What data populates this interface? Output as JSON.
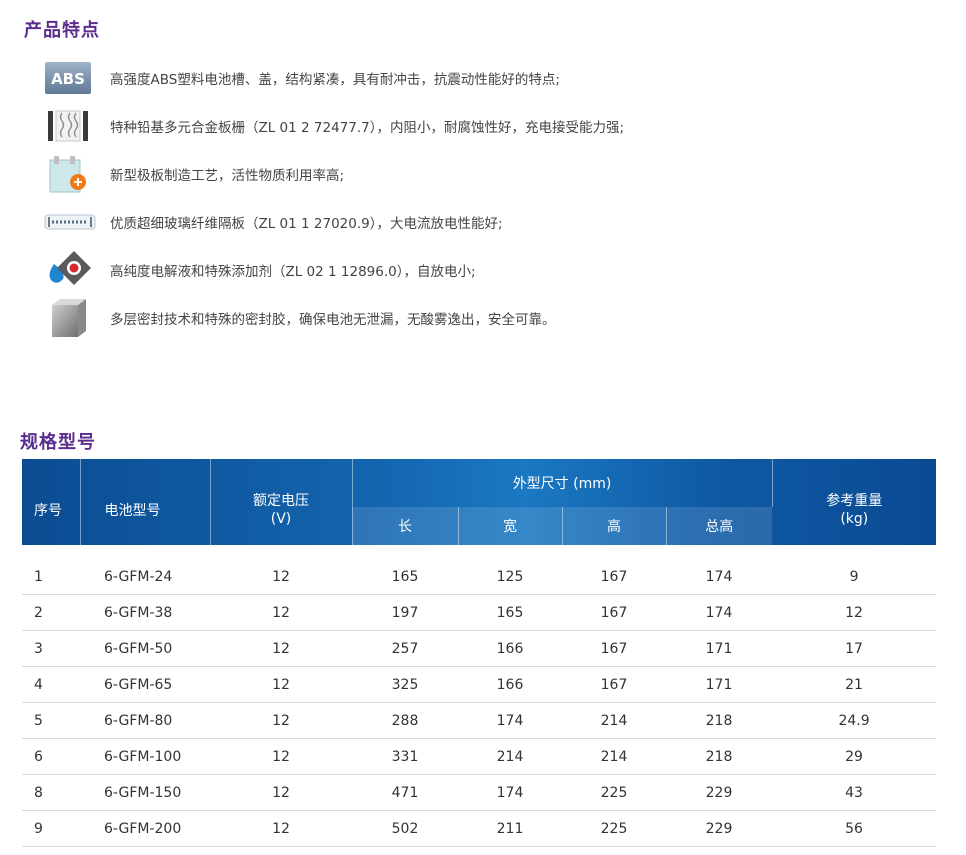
{
  "features": {
    "title": "产品特点",
    "items": [
      {
        "icon": "abs-plastic-icon",
        "label": "ABS",
        "text": "高强度ABS塑料电池槽、盖，结构紧凑，具有耐冲击，抗震动性能好的特点;"
      },
      {
        "icon": "lead-grid-icon",
        "text": "特种铅基多元合金板栅（ZL 01 2 72477.7），内阻小，耐腐蚀性好，充电接受能力强;"
      },
      {
        "icon": "plate-process-icon",
        "text": "新型极板制造工艺，活性物质利用率高;"
      },
      {
        "icon": "glass-fiber-icon",
        "text": "优质超细玻璃纤维隔板（ZL 01 1 27020.9），大电流放电性能好;"
      },
      {
        "icon": "electrolyte-icon",
        "text": "高纯度电解液和特殊添加剂（ZL 02 1 12896.0），自放电小;"
      },
      {
        "icon": "seal-block-icon",
        "text": "多层密封技术和特殊的密封胶，确保电池无泄漏，无酸雾逸出，安全可靠。"
      }
    ]
  },
  "specs": {
    "title": "规格型号",
    "headers": {
      "no": "序号",
      "model": "电池型号",
      "voltage": "额定电压",
      "voltage_unit": "(V)",
      "dims": "外型尺寸 (mm)",
      "length": "长",
      "width": "宽",
      "height": "高",
      "total_height": "总高",
      "weight": "参考重量",
      "weight_unit": "(kg)"
    },
    "rows": [
      [
        "1",
        "6-GFM-24",
        "12",
        "165",
        "125",
        "167",
        "174",
        "9"
      ],
      [
        "2",
        "6-GFM-38",
        "12",
        "197",
        "165",
        "167",
        "174",
        "12"
      ],
      [
        "3",
        "6-GFM-50",
        "12",
        "257",
        "166",
        "167",
        "171",
        "17"
      ],
      [
        "4",
        "6-GFM-65",
        "12",
        "325",
        "166",
        "167",
        "171",
        "21"
      ],
      [
        "5",
        "6-GFM-80",
        "12",
        "288",
        "174",
        "214",
        "218",
        "24.9"
      ],
      [
        "6",
        "6-GFM-100",
        "12",
        "331",
        "214",
        "214",
        "218",
        "29"
      ],
      [
        "8",
        "6-GFM-150",
        "12",
        "471",
        "174",
        "225",
        "229",
        "43"
      ],
      [
        "9",
        "6-GFM-200",
        "12",
        "502",
        "211",
        "225",
        "229",
        "56"
      ]
    ]
  }
}
